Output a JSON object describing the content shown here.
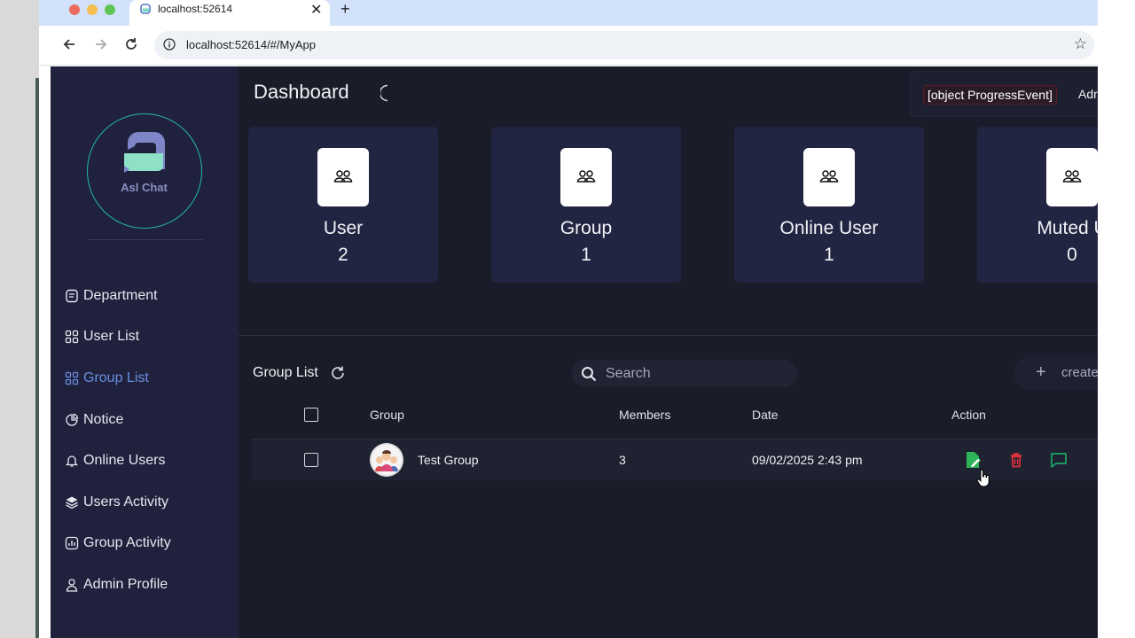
{
  "browser": {
    "tab_title": "localhost:52614",
    "url": "localhost:52614/#/MyApp",
    "new_tab": "+",
    "close_tab": "✕"
  },
  "sidebar": {
    "brand": "Asl Chat",
    "items": [
      {
        "label": "Department",
        "icon": "document-icon",
        "active": false
      },
      {
        "label": "User List",
        "icon": "grid-icon",
        "active": false
      },
      {
        "label": "Group List",
        "icon": "grid-icon",
        "active": true
      },
      {
        "label": "Notice",
        "icon": "pie-icon",
        "active": false
      },
      {
        "label": "Online Users",
        "icon": "bell-icon",
        "active": false
      },
      {
        "label": "Users Activity",
        "icon": "layers-icon",
        "active": false
      },
      {
        "label": "Group Activity",
        "icon": "chart-icon",
        "active": false
      },
      {
        "label": "Admin Profile",
        "icon": "person-icon",
        "active": false
      }
    ]
  },
  "header": {
    "title": "Dashboard",
    "error_chip": "[object ProgressEvent]",
    "admin": "Adr"
  },
  "stats": [
    {
      "label": "User",
      "count": "2"
    },
    {
      "label": "Group",
      "count": "1"
    },
    {
      "label": "Online User",
      "count": "1"
    },
    {
      "label": "Muted U",
      "count": "0"
    }
  ],
  "group_list": {
    "title": "Group List",
    "search_placeholder": "Search",
    "create_label": "create",
    "columns": {
      "group": "Group",
      "members": "Members",
      "date": "Date",
      "action": "Action"
    },
    "rows": [
      {
        "name": "Test Group",
        "members": "3",
        "date": "09/02/2025 2:43 pm"
      }
    ]
  },
  "colors": {
    "sidebar_bg": "#20213d",
    "main_bg": "#1a1d29",
    "card_bg": "#222541",
    "accent_active": "#6a8ee0",
    "logo_ring": "#25b7b0",
    "edit_green": "#2fb35a",
    "delete_red": "#e2323d",
    "chat_green": "#1ca86a"
  }
}
